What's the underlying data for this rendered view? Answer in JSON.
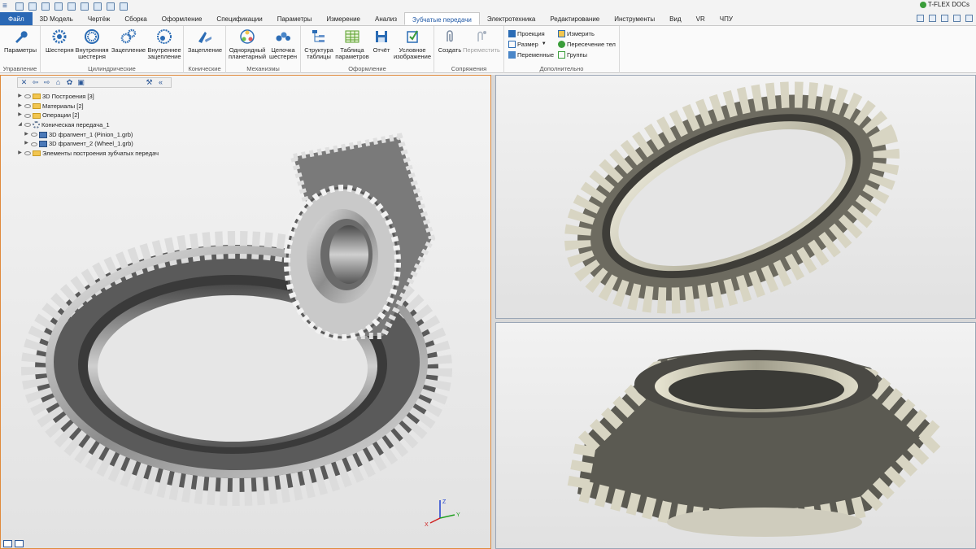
{
  "app": {
    "brand": "T-FLEX DOCs"
  },
  "tabs": [
    {
      "label": "Файл"
    },
    {
      "label": "3D Модель"
    },
    {
      "label": "Чертёж"
    },
    {
      "label": "Сборка"
    },
    {
      "label": "Оформление"
    },
    {
      "label": "Спецификации"
    },
    {
      "label": "Параметры"
    },
    {
      "label": "Измерение"
    },
    {
      "label": "Анализ"
    },
    {
      "label": "Зубчатые передачи"
    },
    {
      "label": "Электротехника"
    },
    {
      "label": "Редактирование"
    },
    {
      "label": "Инструменты"
    },
    {
      "label": "Вид"
    },
    {
      "label": "VR"
    },
    {
      "label": "ЧПУ"
    }
  ],
  "ribbon": {
    "groups": {
      "upravlenie": "Управление",
      "cylindrical": "Цилиндрические",
      "conical": "Конические",
      "mechanisms": "Механизмы",
      "design": "Оформление",
      "mates": "Сопряжения",
      "extra": "Дополнительно"
    },
    "buttons": {
      "params": "Параметры",
      "gear": "Шестерня",
      "internal_gear_1": "Внутренняя",
      "internal_gear_2": "шестерня",
      "mesh": "Зацепление",
      "internal_mesh_1": "Внутреннее",
      "internal_mesh_2": "зацепление",
      "conical_mesh": "Зацепление",
      "planetary_1": "Однорядный",
      "planetary_2": "планетарный",
      "chain_1": "Цепочка",
      "chain_2": "шестерен",
      "table_struct_1": "Структура",
      "table_struct_2": "таблицы",
      "table_params_1": "Таблица",
      "table_params_2": "параметров",
      "report": "Отчёт",
      "cond_image_1": "Условное",
      "cond_image_2": "изображение",
      "create": "Создать",
      "move": "Переместить",
      "projection": "Проекция",
      "measure": "Измерить",
      "dimension": "Размер",
      "body_intersection": "Пересечение тел",
      "variables": "Переменные",
      "groups_btn": "Группы"
    }
  },
  "tree": {
    "items": [
      {
        "label": "3D Построения [3]",
        "level": 0,
        "icon": "folder-icon"
      },
      {
        "label": "Материалы [2]",
        "level": 0,
        "icon": "folder-icon"
      },
      {
        "label": "Операции [2]",
        "level": 0,
        "icon": "folder-icon"
      },
      {
        "label": "Коническая передача_1",
        "level": 0,
        "icon": "gear-pair-icon",
        "expanded": true
      },
      {
        "label": "3D фрагмент_1 (Pinion_1.grb)",
        "level": 1,
        "icon": "fragment-icon"
      },
      {
        "label": "3D фрагмент_2 (Wheel_1.grb)",
        "level": 1,
        "icon": "fragment-icon"
      },
      {
        "label": "Элементы построения зубчатых передач",
        "level": 0,
        "icon": "folder-icon"
      }
    ]
  },
  "axes": {
    "x": "X",
    "y": "Y",
    "z": "Z"
  },
  "colors": {
    "accent": "#2a68b5",
    "active_viewport_border": "#e08a3c",
    "gear_metal": "#cfccbd"
  }
}
